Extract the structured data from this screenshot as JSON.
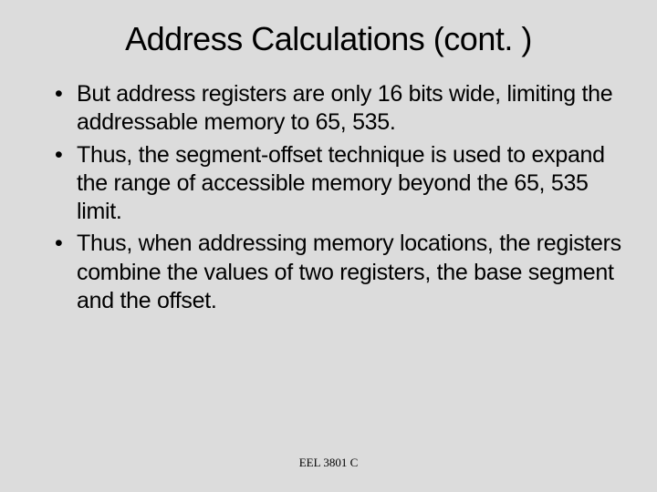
{
  "slide": {
    "title": "Address Calculations (cont. )",
    "bullets": [
      "But address registers are only 16 bits wide, limiting the addressable memory to 65, 535.",
      "Thus, the segment-offset technique is used to expand the range of accessible memory beyond the 65, 535 limit.",
      "Thus, when addressing memory locations, the registers combine the values of two registers, the base segment and the offset."
    ],
    "footer": "EEL 3801 C"
  }
}
